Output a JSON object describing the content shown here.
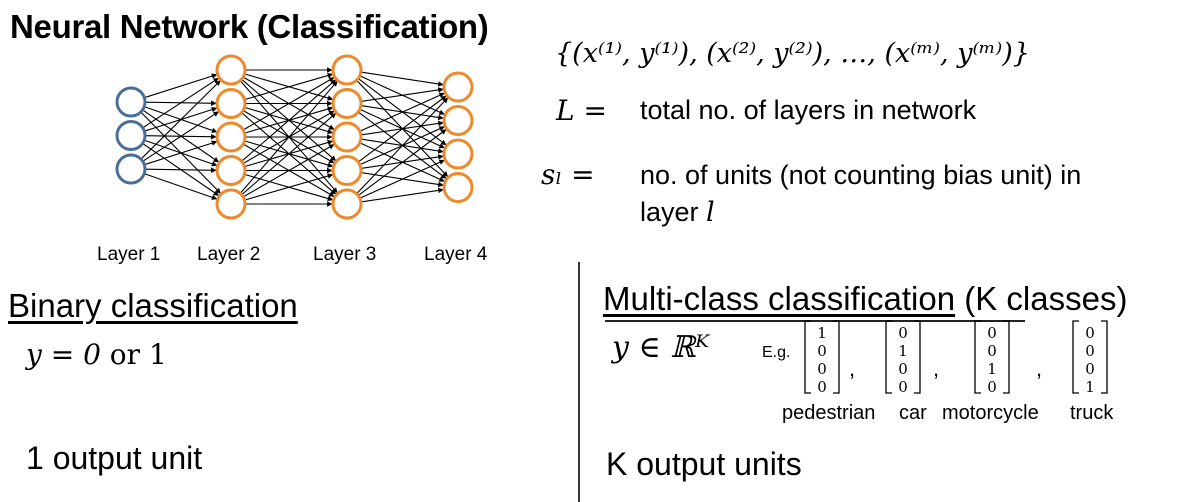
{
  "title": "Neural Network (Classification)",
  "network": {
    "layer_labels": [
      "Layer 1",
      "Layer 2",
      "Layer 3",
      "Layer 4"
    ],
    "units_per_layer": [
      3,
      5,
      5,
      4
    ],
    "input_color": "#4a6f96",
    "hidden_color": "#ee8a2c",
    "edge_color": "#000000"
  },
  "training_set": {
    "formula": "{(x⁽¹⁾, y⁽¹⁾), (x⁽²⁾, y⁽²⁾), …, (x⁽ᵐ⁾, y⁽ᵐ⁾)}"
  },
  "definitions": [
    {
      "symbol": "L =",
      "text": "total no. of layers in network"
    },
    {
      "symbol": "sₗ =",
      "text_line1": "no. of units (not counting bias unit) in",
      "text_line2": "layer",
      "var": "l"
    }
  ],
  "binary": {
    "heading": "Binary classification",
    "formula_y": "y = 0 ",
    "formula_or": "or",
    "formula_one": " 1",
    "output": "1 output unit"
  },
  "multiclass": {
    "heading": "Multi-class classification",
    "heading_suffix": " (K classes)",
    "formula": "y ∈ ℝᴷ",
    "eg_label": "E.g.",
    "vectors": [
      [
        "1",
        "0",
        "0",
        "0"
      ],
      [
        "0",
        "1",
        "0",
        "0"
      ],
      [
        "0",
        "0",
        "1",
        "0"
      ],
      [
        "0",
        "0",
        "0",
        "1"
      ]
    ],
    "separator": ",",
    "vector_labels": [
      "pedestrian",
      "car",
      "motorcycle",
      "truck"
    ],
    "output": "K output units"
  }
}
